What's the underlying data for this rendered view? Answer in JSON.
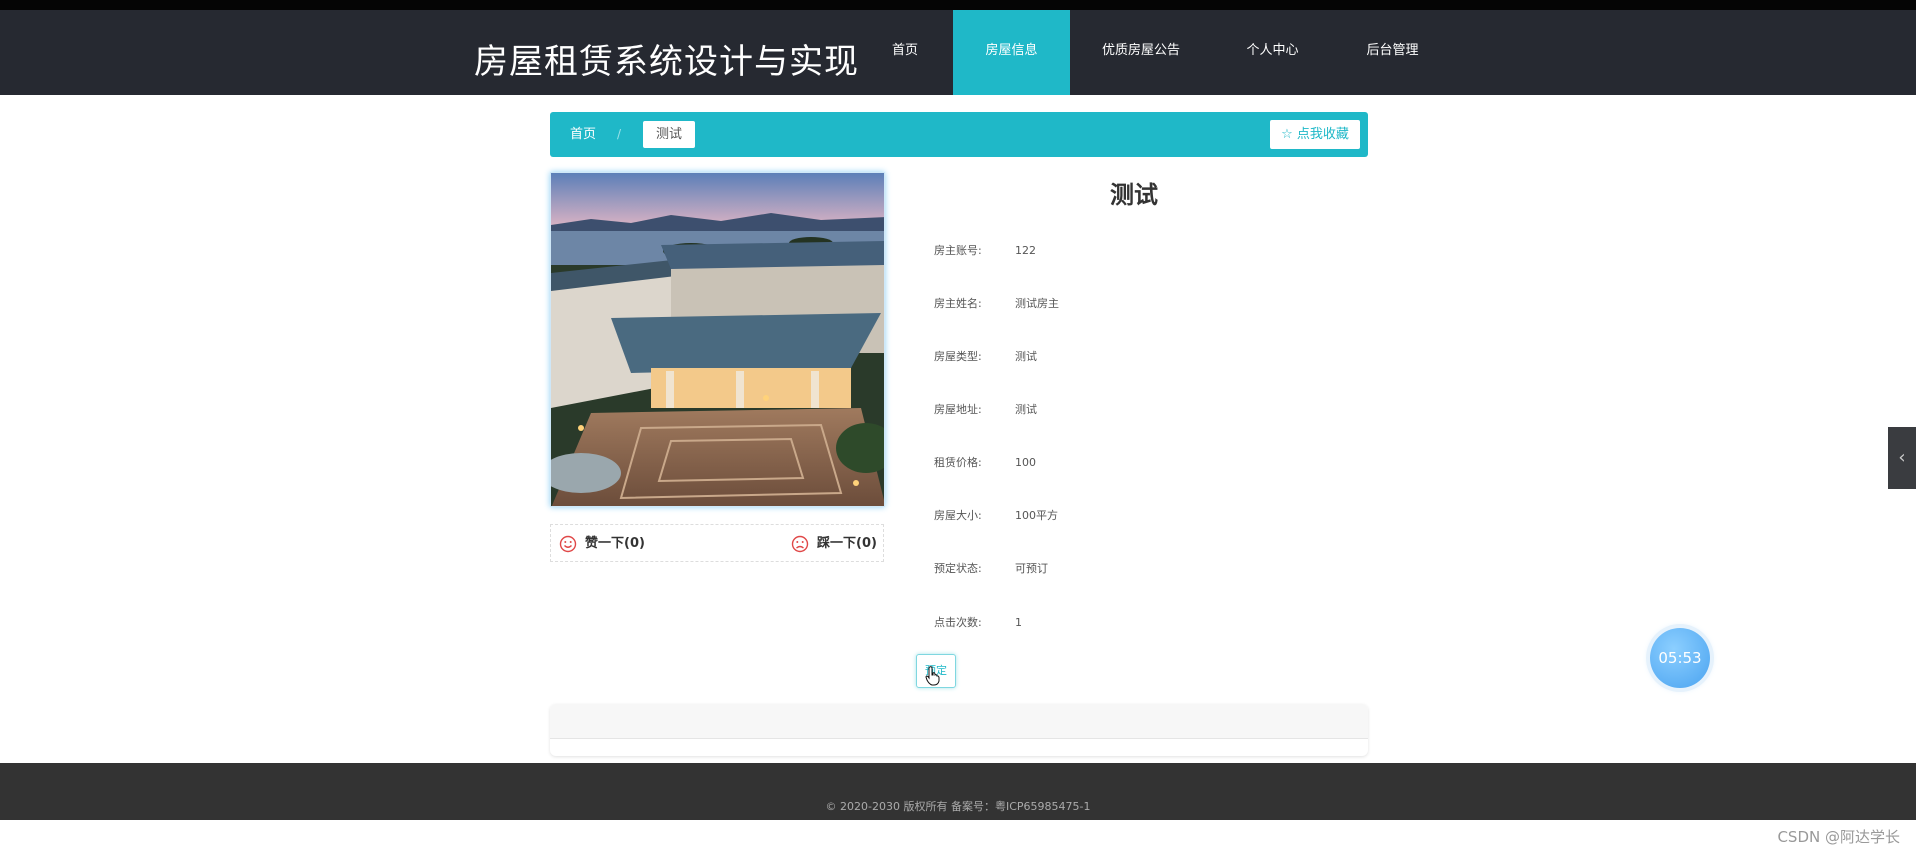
{
  "header": {
    "site_title": "房屋租赁系统设计与实现",
    "nav": [
      {
        "label": "首页"
      },
      {
        "label": "房屋信息",
        "active": true
      },
      {
        "label": "优质房屋公告"
      },
      {
        "label": "个人中心"
      },
      {
        "label": "后台管理"
      }
    ]
  },
  "breadcrumb": {
    "home": "首页",
    "separator": "/",
    "current": "测试",
    "favorite_label": "☆ 点我收藏"
  },
  "votes": {
    "like_label": "赞一下(0)",
    "dislike_label": "踩一下(0)"
  },
  "detail": {
    "title": "测试",
    "fields": [
      {
        "label": "房主账号:",
        "value": "122"
      },
      {
        "label": "房主姓名:",
        "value": "测试房主"
      },
      {
        "label": "房屋类型:",
        "value": "测试"
      },
      {
        "label": "房屋地址:",
        "value": "测试"
      },
      {
        "label": "租赁价格:",
        "value": "100"
      },
      {
        "label": "房屋大小:",
        "value": "100平方"
      },
      {
        "label": "预定状态:",
        "value": "可预订"
      },
      {
        "label": "点击次数:",
        "value": "1"
      }
    ],
    "reserve_label": "预定"
  },
  "footer": {
    "copyright": "© 2020-2030 版权所有 备案号：粤ICP65985475-1"
  },
  "widgets": {
    "timer": "05:53",
    "side_tab_icon": "chevron-left-icon",
    "watermark": "CSDN @阿达学长"
  },
  "colors": {
    "accent": "#1fb8c8",
    "header_bg": "#262931",
    "footer_bg": "#333333"
  }
}
